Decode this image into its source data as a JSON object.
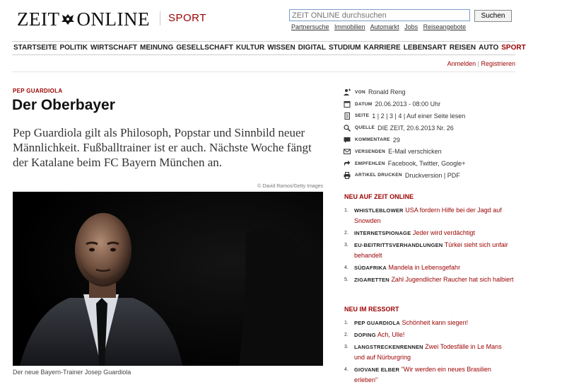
{
  "header": {
    "logo_left": "ZEIT",
    "logo_right": "ONLINE",
    "section": "SPORT",
    "search_placeholder": "ZEIT ONLINE durchsuchen",
    "search_button": "Suchen",
    "quick_links": [
      "Partnersuche",
      "Immobilien",
      "Automarkt",
      "Jobs",
      "Reiseangebote"
    ]
  },
  "nav": {
    "items": [
      "STARTSEITE",
      "POLITIK",
      "WIRTSCHAFT",
      "MEINUNG",
      "GESELLSCHAFT",
      "KULTUR",
      "WISSEN",
      "DIGITAL",
      "STUDIUM",
      "KARRIERE",
      "LEBENSART",
      "REISEN",
      "AUTO",
      "SPORT"
    ],
    "active": "SPORT",
    "login": "Anmelden",
    "separator": "|",
    "register": "Registrieren"
  },
  "article": {
    "kicker": "PEP GUARDIOLA",
    "title": "Der Oberbayer",
    "teaser": "Pep Guardiola gilt als Philosoph, Popstar und Sinnbild neuer Männlichkeit. Fußballtrainer ist er auch. Nächste Woche fängt der Katalane beim FC Bayern München an.",
    "photo_credit": "© David Ramos/Getty Images",
    "caption": "Der neue Bayern-Trainer Josep Guardiola"
  },
  "meta": [
    {
      "key": "VON",
      "value": "Ronald Reng",
      "icon": "person-icon",
      "link": false
    },
    {
      "key": "DATUM",
      "value": "20.06.2013 - 08:00 Uhr",
      "icon": "calendar-icon",
      "link": false
    },
    {
      "key": "SEITE",
      "value": "1 | 2 | 3 | 4 | Auf einer Seite lesen",
      "icon": "page-icon",
      "link": true
    },
    {
      "key": "QUELLE",
      "value": "DIE ZEIT, 20.6.2013 Nr. 26",
      "icon": "source-icon",
      "link": true
    },
    {
      "key": "KOMMENTARE",
      "value": "29",
      "icon": "comment-icon",
      "link": true
    },
    {
      "key": "VERSENDEN",
      "value": "E-Mail verschicken",
      "icon": "mail-icon",
      "link": true
    },
    {
      "key": "EMPFEHLEN",
      "value": "Facebook, Twitter, Google+",
      "icon": "share-icon",
      "link": true
    },
    {
      "key": "ARTIKEL DRUCKEN",
      "value": "Druckversion | PDF",
      "icon": "print-icon",
      "link": true
    }
  ],
  "new_on_zeit": {
    "heading": "NEU AUF ZEIT ONLINE",
    "items": [
      {
        "num": "1.",
        "kicker": "WHISTLEBLOWER",
        "text": "USA fordern Hilfe bei der Jagd auf Snowden"
      },
      {
        "num": "2.",
        "kicker": "INTERNETSPIONAGE",
        "text": "Jeder wird verdächtigt"
      },
      {
        "num": "3.",
        "kicker": "EU-BEITRITTSVERHANDLUNGEN",
        "text": "Türkei sieht sich unfair behandelt"
      },
      {
        "num": "4.",
        "kicker": "SÜDAFRIKA",
        "text": "Mandela in Lebensgefahr"
      },
      {
        "num": "5.",
        "kicker": "ZIGARETTEN",
        "text": "Zahl Jugendlicher Raucher hat sich halbiert"
      }
    ]
  },
  "new_in_section": {
    "heading": "NEU IM RESSORT",
    "items": [
      {
        "num": "1.",
        "kicker": "PEP GUARDIOLA",
        "text": "Schönheit kann siegen!"
      },
      {
        "num": "2.",
        "kicker": "DOPING",
        "text": "Ach, Ulle!"
      },
      {
        "num": "3.",
        "kicker": "LANGSTRECKENRENNEN",
        "text": "Zwei Todesfälle in Le Mans und auf Nürburgring"
      },
      {
        "num": "4.",
        "kicker": "GIOVANE ELBER",
        "text": "\"Wir werden ein neues Brasilien erleben\""
      }
    ]
  },
  "colors": {
    "accent": "#9b0000",
    "text": "#222222",
    "nav_border": "#cccccc"
  }
}
